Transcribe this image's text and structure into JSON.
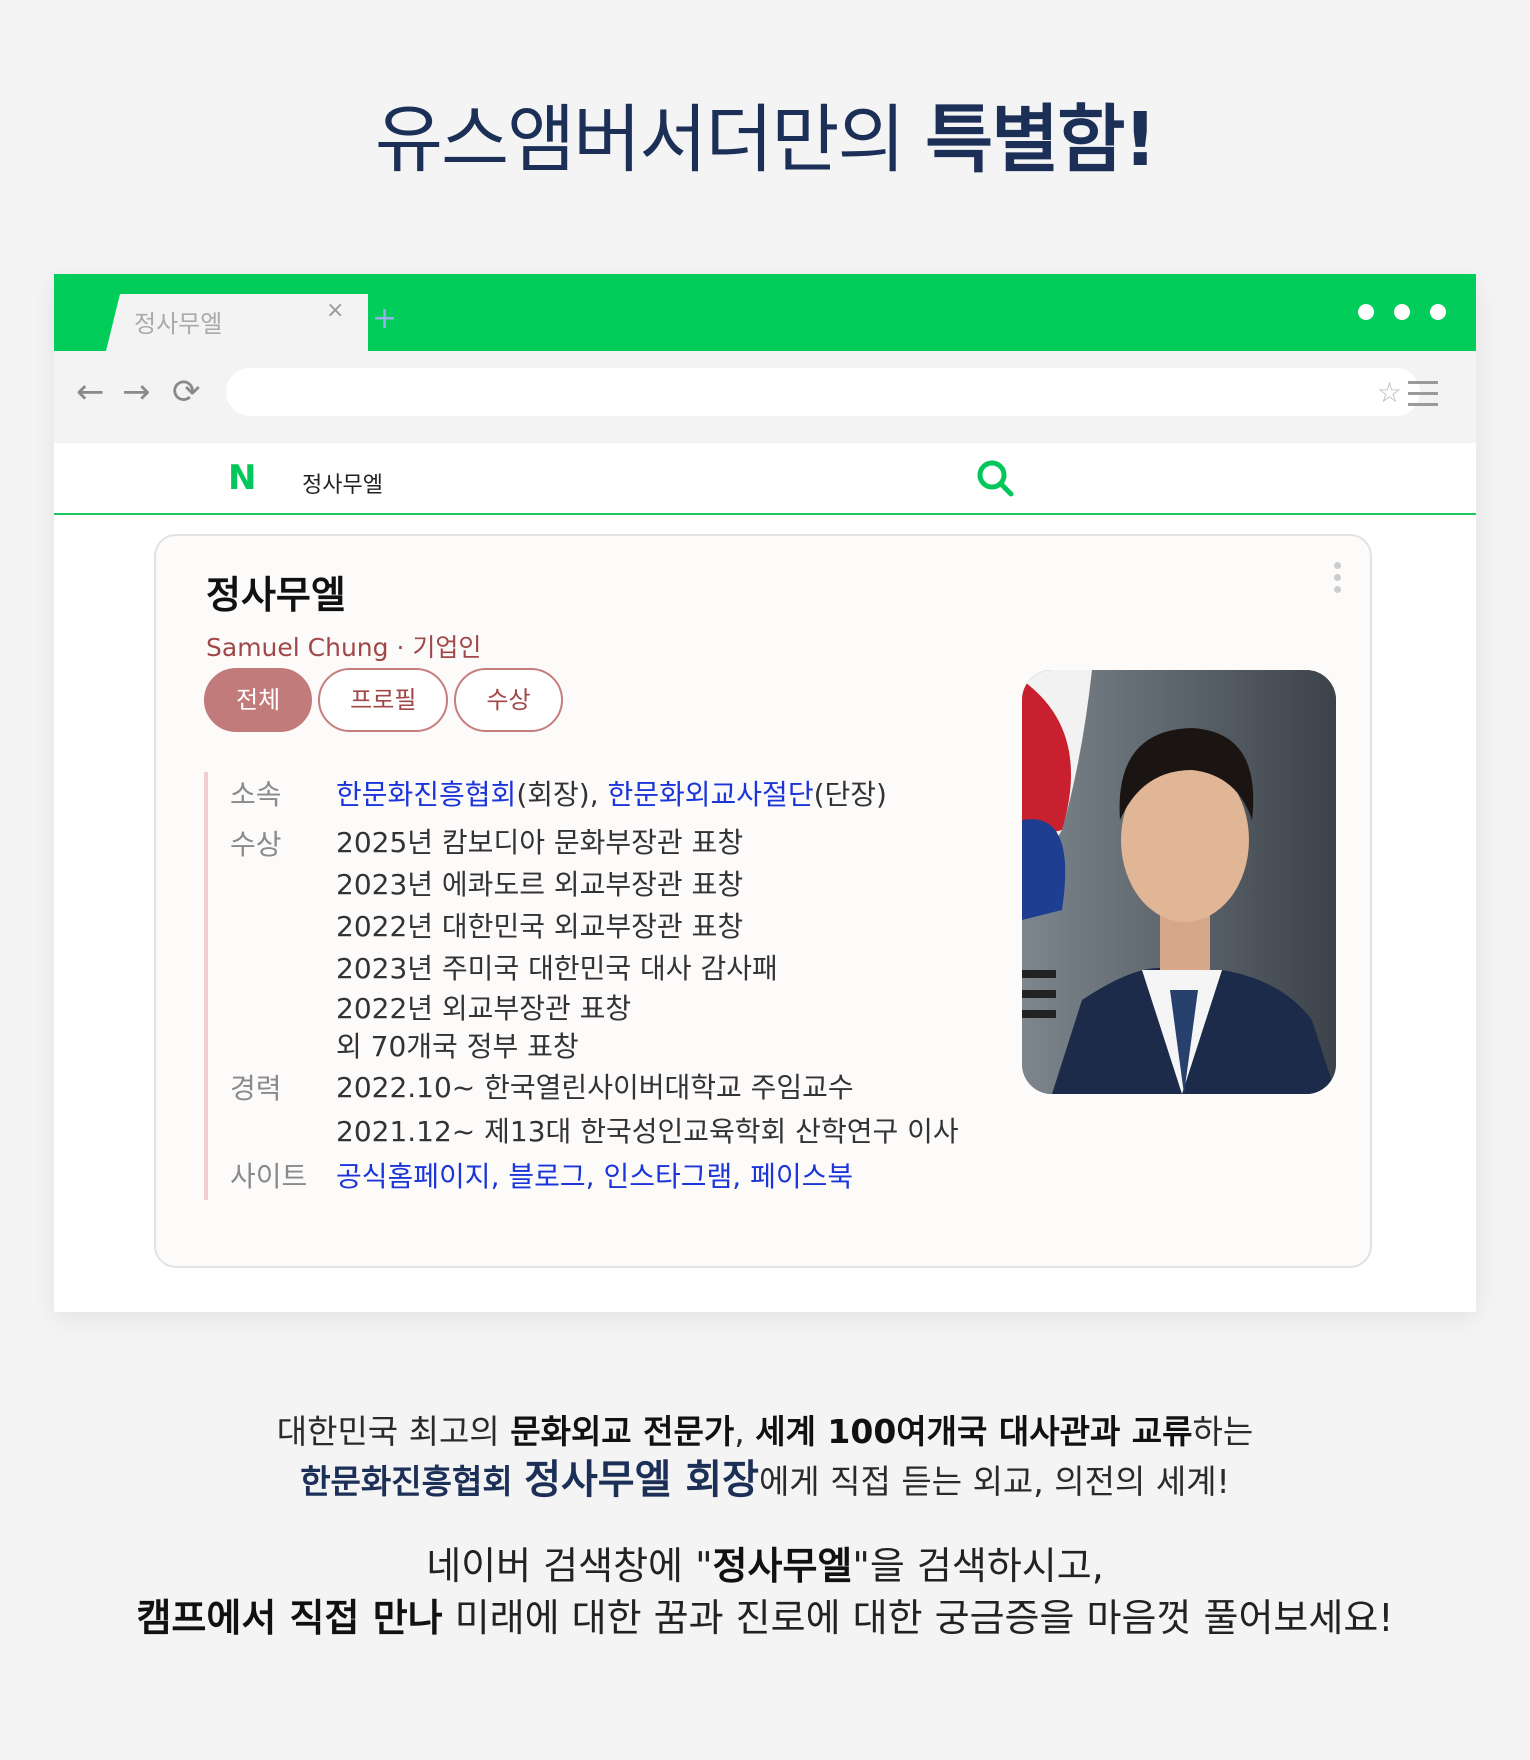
{
  "headline": {
    "light": "유스앰버서더만의 ",
    "bold": "특별함!"
  },
  "browser": {
    "tab_title": "정사무엘",
    "tab_close": "×",
    "tab_add": "+",
    "back": "←",
    "forward": "→",
    "reload": "⟳",
    "star": "☆",
    "search_query": "정사무엘",
    "naver_logo": "N"
  },
  "card": {
    "title": "정사무엘",
    "subtitle": "Samuel Chung · 기업인",
    "tabs": [
      "전체",
      "프로필",
      "수상"
    ],
    "rows": {
      "affiliation_label": "소속",
      "affiliation_link1": "한문화진흥협회",
      "affiliation_role1": "(회장), ",
      "affiliation_link2": "한문화외교사절단",
      "affiliation_role2": "(단장)",
      "awards_label": "수상",
      "awards": [
        "2025년 캄보디아 문화부장관 표창",
        "2023년 에콰도르 외교부장관 표창",
        "2022년 대한민국 외교부장관 표창",
        "2023년 주미국 대한민국 대사 감사패",
        "2022년 외교부장관 표창",
        "외 70개국 정부 표창"
      ],
      "career_label": "경력",
      "career": [
        "2022.10~ 한국열린사이버대학교 주임교수",
        "2021.12~ 제13대 한국성인교육학회 산학연구 이사"
      ],
      "sites_label": "사이트",
      "sites": [
        "공식홈페이지",
        "블로그",
        "인스타그램",
        "페이스북"
      ]
    }
  },
  "bottom": {
    "l1_a": "대한민국 최고의 ",
    "l1_b": "문화외교 전문가",
    "l1_c": ", ",
    "l1_d": "세계 100여개국 대사관과 교류",
    "l1_e": "하는",
    "l2_a": "한문화진흥협회 ",
    "l2_b": "정사무엘 회장",
    "l2_c": "에게 직접 듣는 외교, 의전의 세계!",
    "l3_a": "네이버 검색창에 \"",
    "l3_b": "정사무엘",
    "l3_c": "\"을 검색하시고,",
    "l4_a": "캠프에서 직접 만나",
    "l4_b": " 미래에 대한 꿈과 진로에 대한 궁금증을 마음껏 풀어보세요!"
  },
  "colors": {
    "naver_green": "#03cd5a",
    "navy": "#1b2f57",
    "link_blue": "#1a35d8",
    "rose": "#c27b7b"
  }
}
